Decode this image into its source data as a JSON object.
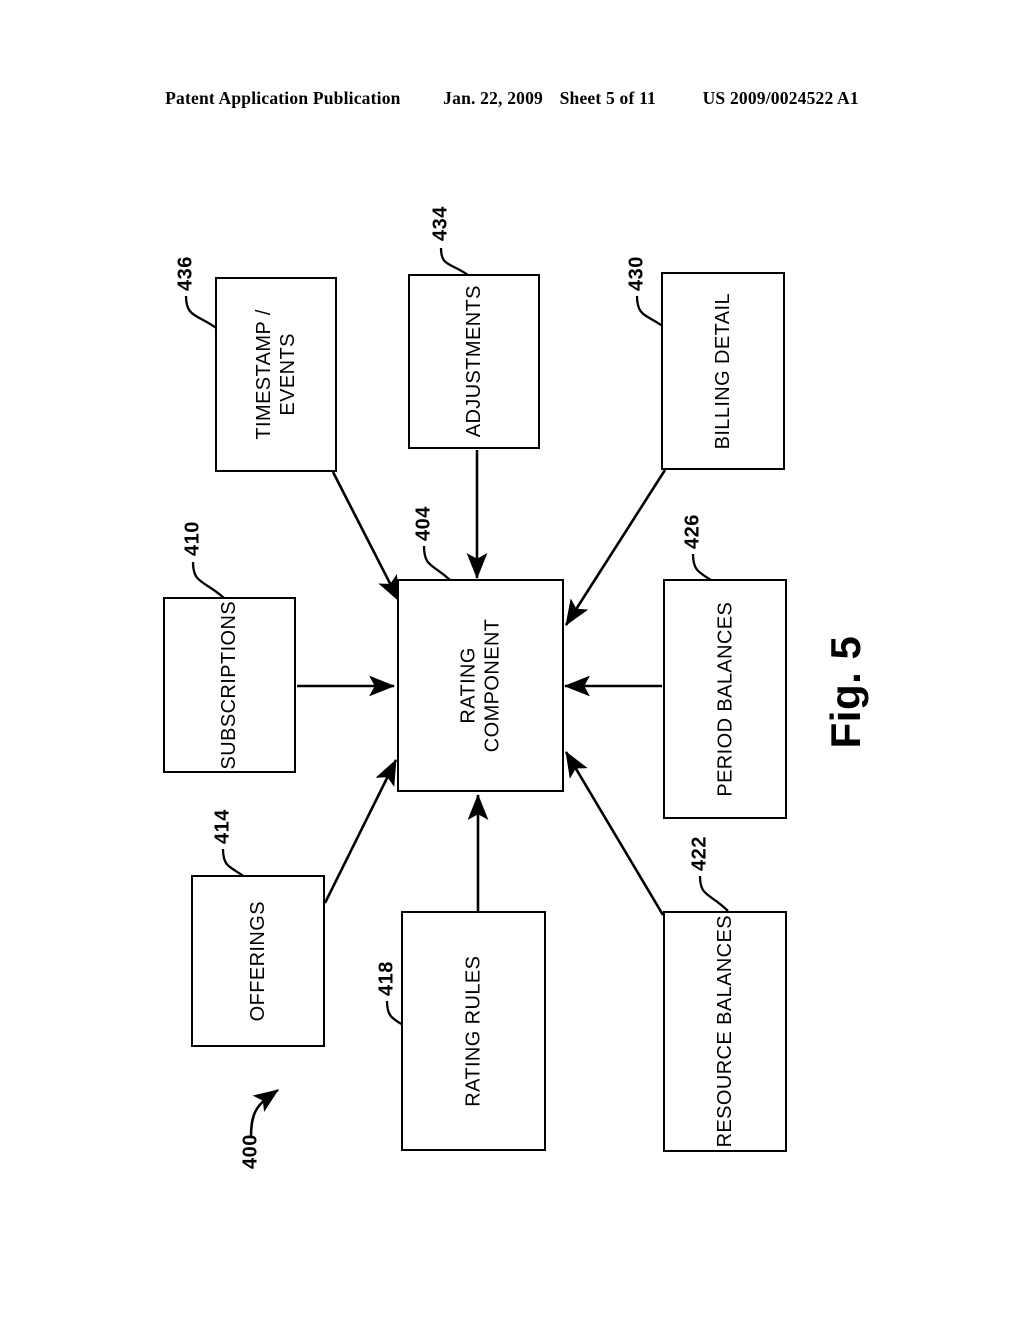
{
  "header": {
    "publication": "Patent Application Publication",
    "date": "Jan. 22, 2009",
    "sheet": "Sheet 5 of 11",
    "number": "US 2009/0024522 A1"
  },
  "figure": {
    "caption": "Fig. 5",
    "system_ref": "400",
    "nodes": [
      {
        "id": "timestamp-events",
        "label": "TIMESTAMP /\nEVENTS",
        "ref": "436"
      },
      {
        "id": "adjustments",
        "label": "ADJUSTMENTS",
        "ref": "434"
      },
      {
        "id": "billing-detail",
        "label": "BILLING DETAIL",
        "ref": "430"
      },
      {
        "id": "subscriptions",
        "label": "SUBSCRIPTIONS",
        "ref": "410"
      },
      {
        "id": "rating-component",
        "label": "RATING\nCOMPONENT",
        "ref": "404"
      },
      {
        "id": "period-balances",
        "label": "PERIOD BALANCES",
        "ref": "426"
      },
      {
        "id": "offerings",
        "label": "OFFERINGS",
        "ref": "414"
      },
      {
        "id": "rating-rules",
        "label": "RATING RULES",
        "ref": "418"
      },
      {
        "id": "resource-balances",
        "label": "RESOURCE BALANCES",
        "ref": "422"
      }
    ],
    "connections": [
      {
        "from": "timestamp-events",
        "to": "rating-component",
        "style": "diagonal"
      },
      {
        "from": "adjustments",
        "to": "rating-component",
        "style": "vertical"
      },
      {
        "from": "billing-detail",
        "to": "rating-component",
        "style": "diagonal"
      },
      {
        "from": "subscriptions",
        "to": "rating-component",
        "style": "horizontal"
      },
      {
        "from": "period-balances",
        "to": "rating-component",
        "style": "horizontal"
      },
      {
        "from": "offerings",
        "to": "rating-component",
        "style": "diagonal"
      },
      {
        "from": "rating-rules",
        "to": "rating-component",
        "style": "vertical"
      },
      {
        "from": "resource-balances",
        "to": "rating-component",
        "style": "diagonal"
      }
    ]
  },
  "colors": {
    "ink": "#000000",
    "paper": "#ffffff"
  }
}
